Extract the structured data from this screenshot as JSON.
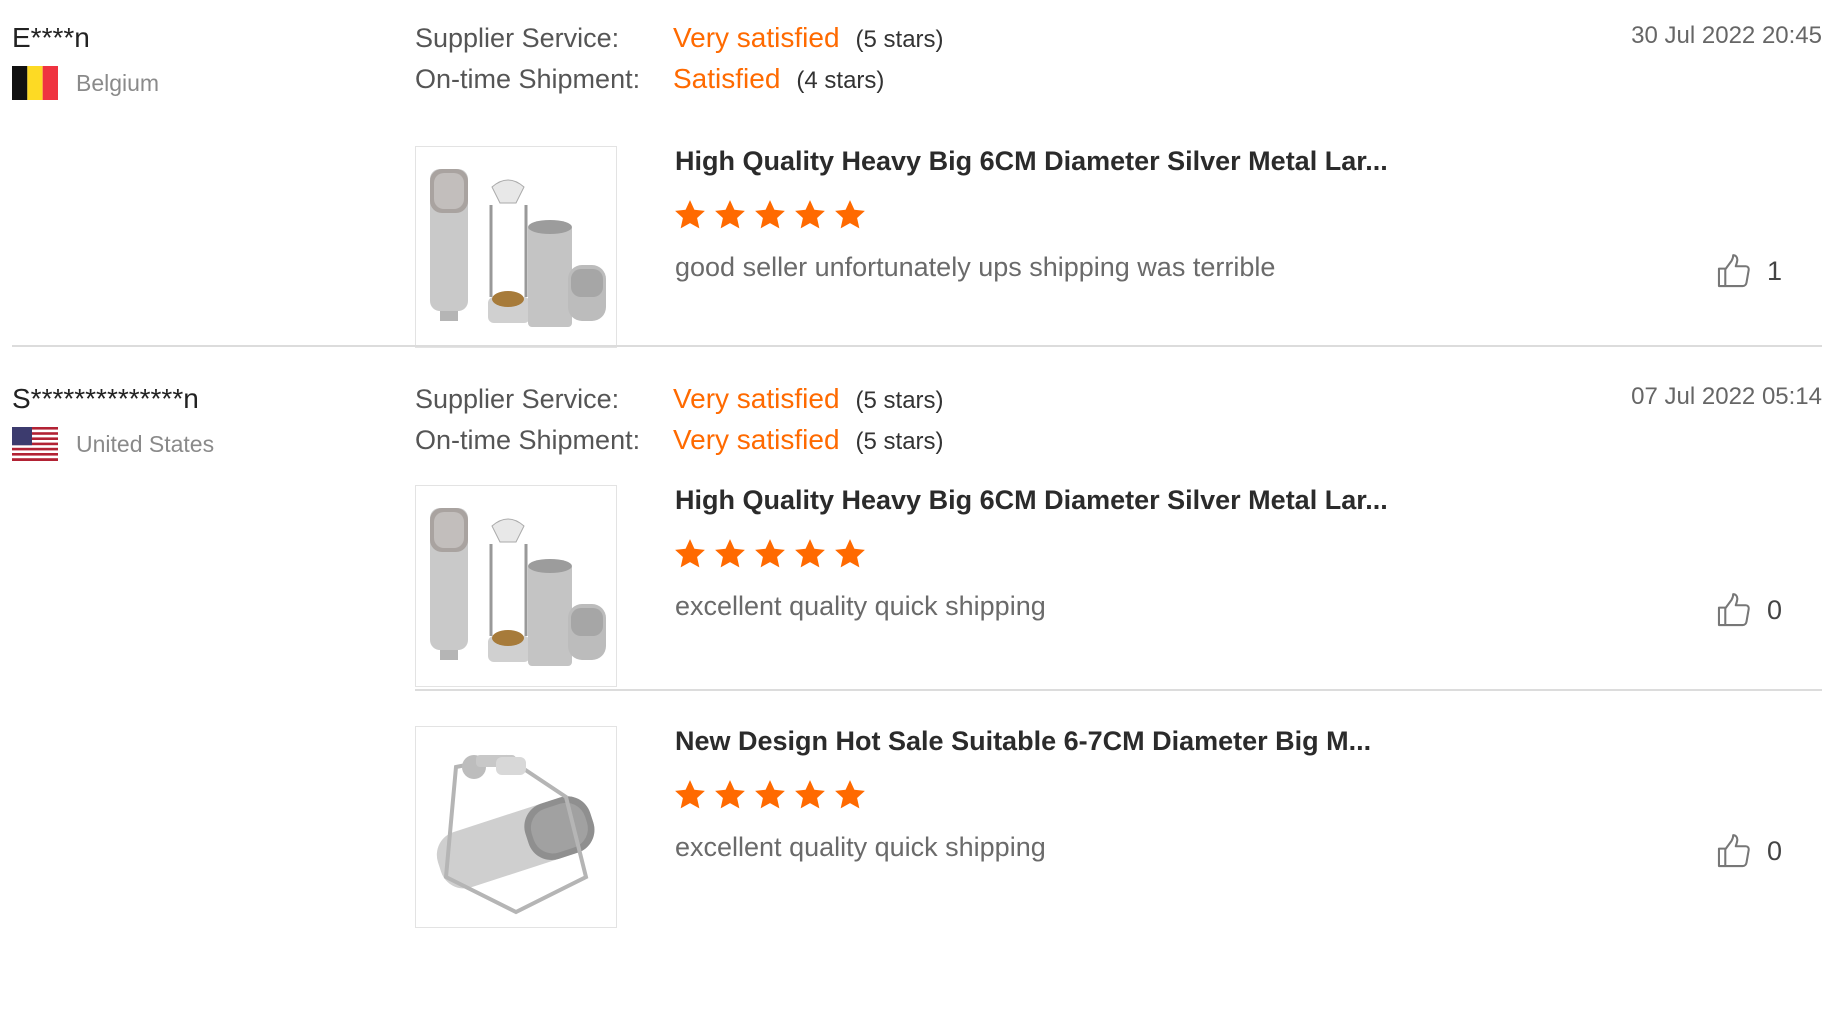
{
  "reviews": [
    {
      "buyer": "E****n",
      "country": "Belgium",
      "date": "30 Jul 2022 20:45",
      "supplier_service": {
        "label": "Supplier Service:",
        "value": "Very satisfied",
        "stars_text": "(5 stars)"
      },
      "shipment": {
        "label": "On-time Shipment:",
        "value": "Satisfied",
        "stars_text": "(4 stars)"
      },
      "products": [
        {
          "title": "High Quality Heavy Big 6CM Diameter Silver Metal Lar...",
          "rating": 5,
          "comment": "good seller unfortunately ups shipping was terrible",
          "likes": "1"
        }
      ]
    },
    {
      "buyer": "S**************n",
      "country": "United States",
      "date": "07 Jul 2022 05:14",
      "supplier_service": {
        "label": "Supplier Service:",
        "value": "Very satisfied",
        "stars_text": "(5 stars)"
      },
      "shipment": {
        "label": "On-time Shipment:",
        "value": "Very satisfied",
        "stars_text": "(5 stars)"
      },
      "products": [
        {
          "title": "High Quality Heavy Big 6CM Diameter Silver Metal Lar...",
          "rating": 5,
          "comment": "excellent quality quick shipping",
          "likes": "0"
        },
        {
          "title": "New Design Hot Sale Suitable 6-7CM Diameter Big M...",
          "rating": 5,
          "comment": "excellent quality quick shipping",
          "likes": "0"
        }
      ]
    }
  ],
  "colors": {
    "accent": "#ff6a00",
    "star": "#ff6a00",
    "divider": "#dcdcdc"
  },
  "icons": {
    "like": "thumbs-up-icon",
    "star": "star-icon"
  }
}
